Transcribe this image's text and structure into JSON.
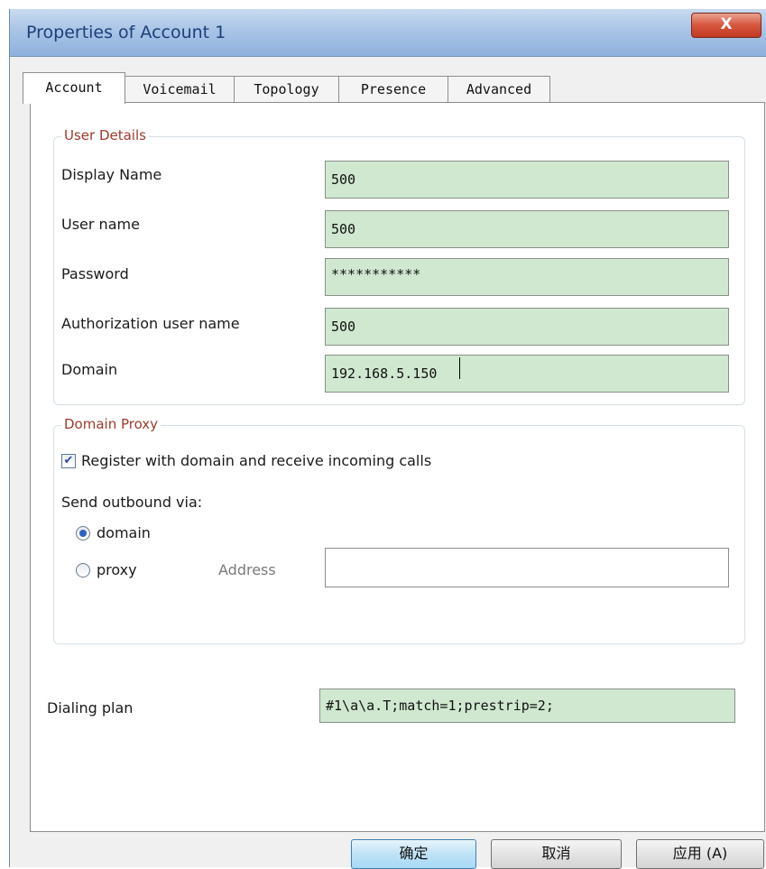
{
  "window": {
    "title": "Properties of Account 1",
    "close_label": "X"
  },
  "tabs": [
    {
      "label": "Account",
      "active": true
    },
    {
      "label": "Voicemail",
      "active": false
    },
    {
      "label": "Topology",
      "active": false
    },
    {
      "label": "Presence",
      "active": false
    },
    {
      "label": "Advanced",
      "active": false
    }
  ],
  "user_details": {
    "legend": "User Details",
    "display_name": {
      "label": "Display Name",
      "value": "500"
    },
    "user_name": {
      "label": "User name",
      "value": "500"
    },
    "password": {
      "label": "Password",
      "value": "***********"
    },
    "auth_user_name": {
      "label": "Authorization user name",
      "value": "500"
    },
    "domain": {
      "label": "Domain",
      "value": "192.168.5.150"
    }
  },
  "domain_proxy": {
    "legend": "Domain Proxy",
    "register_checkbox": {
      "label": "Register with domain and receive incoming calls",
      "checked": true
    },
    "send_outbound_label": "Send outbound via:",
    "radio_domain": {
      "label": "domain",
      "selected": true
    },
    "radio_proxy": {
      "label": "proxy",
      "selected": false
    },
    "address": {
      "label": "Address",
      "value": ""
    }
  },
  "dialing_plan": {
    "label": "Dialing plan",
    "value": "#1\\a\\a.T;match=1;prestrip=2;"
  },
  "buttons": {
    "ok": "确定",
    "cancel": "取消",
    "apply": "应用 (A)"
  },
  "colors": {
    "field_bg": "#cfe8cf",
    "legend_text": "#9e3a2b",
    "title_text": "#1d3f78"
  }
}
